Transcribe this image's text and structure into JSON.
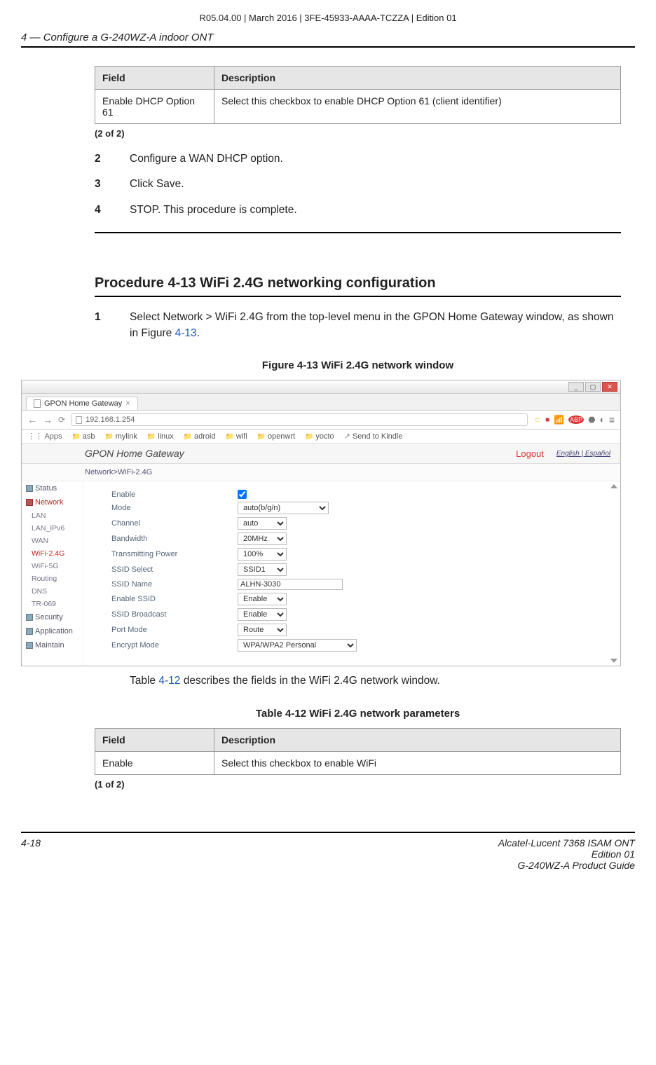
{
  "doc_header": "R05.04.00 | March 2016 | 3FE-45933-AAAA-TCZZA | Edition 01",
  "chapter": {
    "num": "4 —",
    "title": "Configure a G-240WZ-A indoor ONT"
  },
  "table_a": {
    "head_field": "Field",
    "head_desc": "Description",
    "row_field": "Enable DHCP Option 61",
    "row_desc": "Select this checkbox to enable DHCP Option 61 (client identifier)",
    "pager": "(2 of 2)"
  },
  "steps_a": [
    {
      "n": "2",
      "t": "Configure a WAN DHCP option."
    },
    {
      "n": "3",
      "t": "Click Save."
    },
    {
      "n": "4",
      "t": "STOP. This procedure is complete."
    }
  ],
  "procedure_title": "Procedure 4-13  WiFi 2.4G networking configuration",
  "step1": {
    "n": "1",
    "pre": "Select Network > WiFi 2.4G from the top-level menu in the GPON Home Gateway window, as shown in Figure ",
    "link": "4-13",
    "post": "."
  },
  "figure_caption": "Figure 4-13  WiFi 2.4G network window",
  "browser": {
    "tab_title": "GPON Home Gateway",
    "url": "192.168.1.254",
    "bookmarks": {
      "apps": "Apps",
      "asb": "asb",
      "mylink": "mylink",
      "linux": "linux",
      "adroid": "adroid",
      "wifi": "wifi",
      "openwrt": "openwrt",
      "yocto": "yocto",
      "kindle": "Send to Kindle"
    }
  },
  "ont": {
    "brand": "GPON Home Gateway",
    "logout": "Logout",
    "lang_en": "English",
    "lang_es": "Español",
    "breadcrumb": "Network>WiFi-2.4G",
    "sidebar": {
      "status": "Status",
      "network": "Network",
      "lan": "LAN",
      "lanv6": "LAN_IPv6",
      "wan": "WAN",
      "w24": "WiFi-2.4G",
      "w5": "WiFi-5G",
      "routing": "Routing",
      "dns": "DNS",
      "tr069": "TR-069",
      "security": "Security",
      "application": "Application",
      "maintain": "Maintain"
    },
    "form": {
      "enable": "Enable",
      "mode": "Mode",
      "mode_v": "auto(b/g/n)",
      "channel": "Channel",
      "channel_v": "auto",
      "bandwidth": "Bandwidth",
      "bandwidth_v": "20MHz",
      "txpower": "Transmitting Power",
      "txpower_v": "100%",
      "ssidsel": "SSID Select",
      "ssidsel_v": "SSID1",
      "ssidname": "SSID Name",
      "ssidname_v": "ALHN-3030",
      "enssid": "Enable SSID",
      "enssid_v": "Enable",
      "ssidbcast": "SSID Broadcast",
      "ssidbcast_v": "Enable",
      "portmode": "Port Mode",
      "portmode_v": "Route",
      "encmode": "Encrypt Mode",
      "encmode_v": "WPA/WPA2 Personal"
    }
  },
  "after_fig": {
    "pre": "Table ",
    "link": "4-12",
    "post": " describes the fields in the WiFi 2.4G network window."
  },
  "table_b_caption": "Table 4-12 WiFi 2.4G network parameters",
  "table_b": {
    "head_field": "Field",
    "head_desc": "Description",
    "row_field": "Enable",
    "row_desc": "Select this checkbox to enable WiFi",
    "pager": "(1 of 2)"
  },
  "footer": {
    "page": "4-18",
    "l1": "Alcatel-Lucent 7368 ISAM ONT",
    "l2": "Edition 01",
    "l3": "G-240WZ-A Product Guide"
  }
}
